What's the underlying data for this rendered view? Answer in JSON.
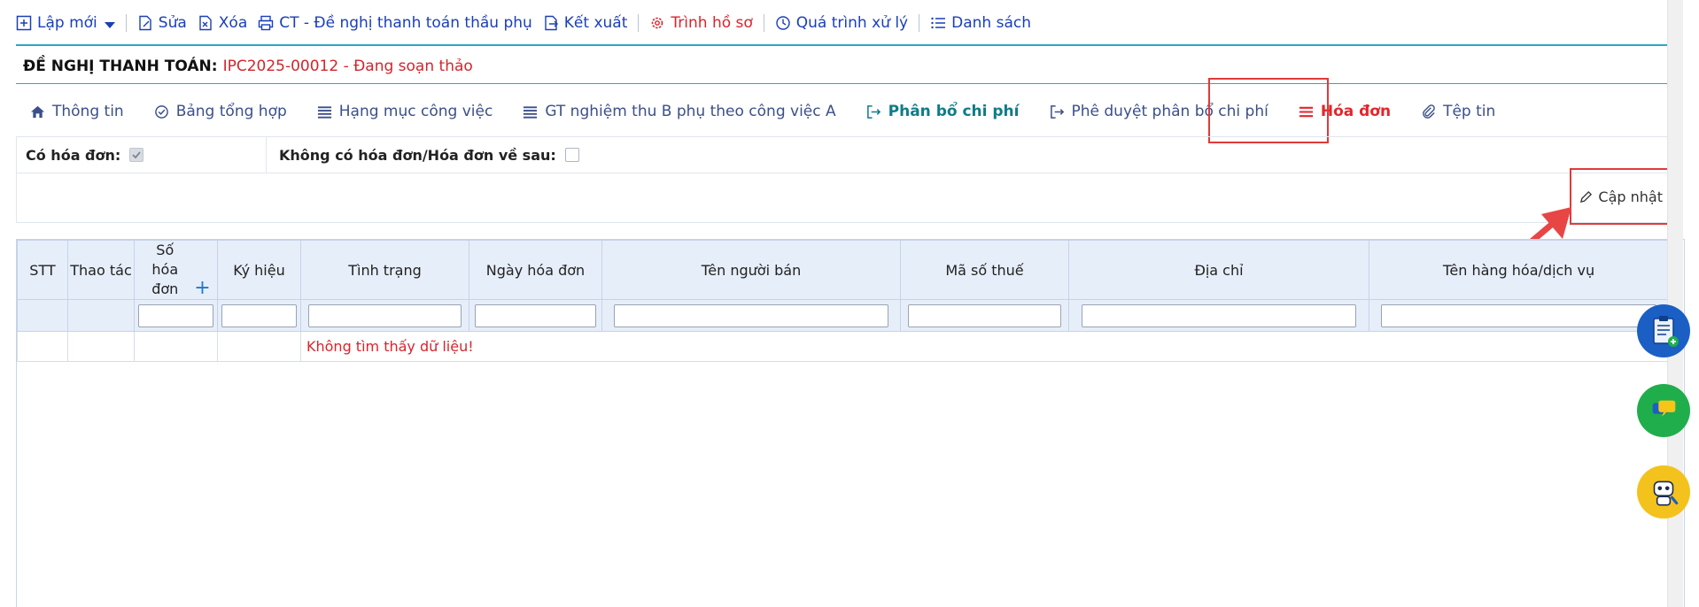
{
  "toolbar": {
    "new_label": "Lập mới",
    "edit_label": "Sửa",
    "delete_label": "Xóa",
    "print_label": "CT - Đề nghị thanh toán thầu phụ",
    "export_label": "Kết xuất",
    "submit_label": "Trình hồ sơ",
    "history_label": "Quá trình xử lý",
    "list_label": "Danh sách"
  },
  "header": {
    "label": "ĐỀ NGHỊ THANH TOÁN:",
    "value": "IPC2025-00012 - Đang soạn thảo"
  },
  "tabs": [
    {
      "label": "Thông tin"
    },
    {
      "label": "Bảng tổng hợp"
    },
    {
      "label": "Hạng mục công việc"
    },
    {
      "label": "GT nghiệm thu B phụ theo công việc A"
    },
    {
      "label": "Phân bổ chi phí"
    },
    {
      "label": "Phê duyệt phân bổ chi phí"
    },
    {
      "label": "Hóa đơn"
    },
    {
      "label": "Tệp tin"
    }
  ],
  "options": {
    "has_invoice_label": "Có hóa đơn:",
    "has_invoice_checked": true,
    "no_invoice_label": "Không có hóa đơn/Hóa đơn về sau:",
    "no_invoice_checked": false
  },
  "update_label": "Cập nhật",
  "table": {
    "columns": [
      "STT",
      "Thao tác",
      "Số hóa đơn",
      "Ký hiệu",
      "Tình trạng",
      "Ngày hóa đơn",
      "Tên người bán",
      "Mã số thuế",
      "Địa chỉ",
      "Tên hàng hóa/dịch vụ"
    ],
    "empty_message": "Không tìm thấy dữ liệu!"
  },
  "colors": {
    "accent": "#2aa6c9",
    "active_tab": "#e3262b",
    "link": "#1a3fb8"
  }
}
